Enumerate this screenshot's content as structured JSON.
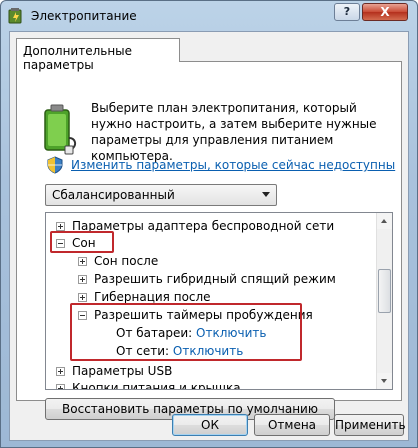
{
  "window": {
    "title": "Электропитание",
    "help_label": "?",
    "close_label": "X"
  },
  "tab": {
    "label": "Дополнительные параметры"
  },
  "header": {
    "description": "Выберите план электропитания, который нужно настроить, а затем выберите нужные параметры для управления питанием компьютера.",
    "change_link": "Изменить параметры, которые сейчас недоступны"
  },
  "plan_select": {
    "value": "Сбалансированный"
  },
  "tree": {
    "items": [
      {
        "label": "Параметры адаптера беспроводной сети",
        "state": "collapsed"
      },
      {
        "label": "Сон",
        "state": "expanded"
      },
      {
        "label": "Сон после",
        "state": "collapsed"
      },
      {
        "label": "Разрешить гибридный спящий режим",
        "state": "collapsed"
      },
      {
        "label": "Гибернация после",
        "state": "collapsed"
      },
      {
        "label": "Разрешить таймеры пробуждения",
        "state": "expanded"
      },
      {
        "label": "От батареи:",
        "value": "Отключить"
      },
      {
        "label": "От сети:",
        "value": "Отключить"
      },
      {
        "label": "Параметры USB",
        "state": "collapsed"
      },
      {
        "label": "Кнопки питания и крышка",
        "state": "collapsed"
      }
    ]
  },
  "restore_button": {
    "label": "Восстановить параметры по умолчанию"
  },
  "buttons": {
    "ok": "ОК",
    "cancel": "Отмена",
    "apply": "Применить"
  },
  "colors": {
    "link": "#0a5fb0",
    "highlight": "#c0282c"
  }
}
